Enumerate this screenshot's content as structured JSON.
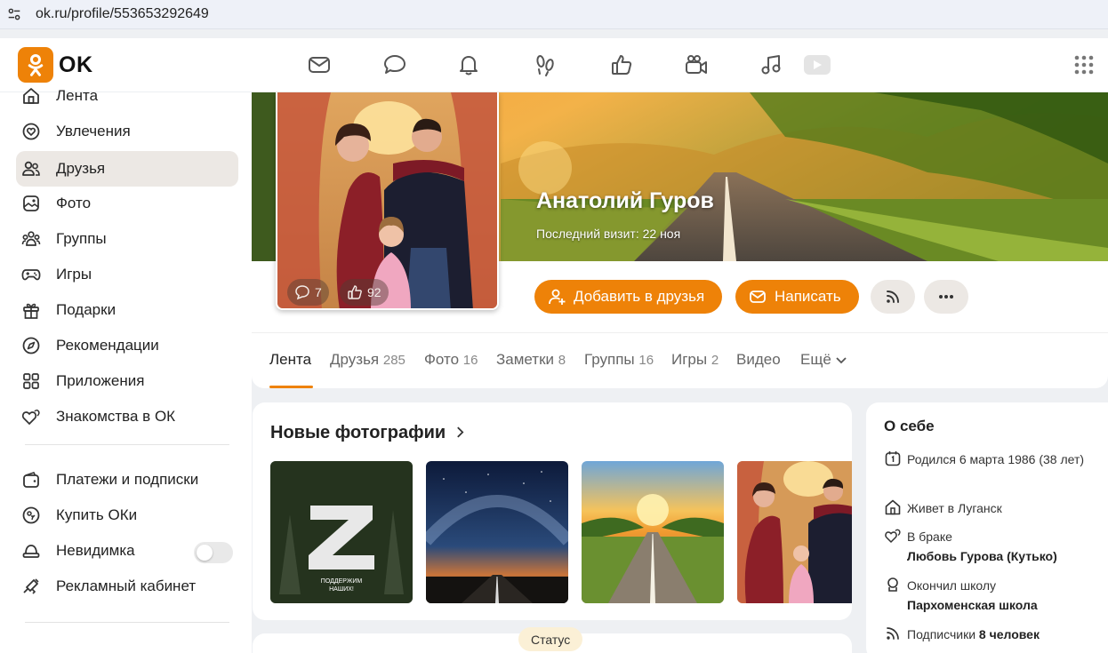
{
  "browser": {
    "url": "ok.ru/profile/553653292649"
  },
  "header": {
    "logo_text": "OK",
    "nav_icons": [
      "mail-icon",
      "chat-icon",
      "bell-icon",
      "footprints-icon",
      "like-icon",
      "video-camera-icon",
      "music-icon",
      "video-play-icon"
    ],
    "apps_icon": "apps-grid-icon"
  },
  "sidebar": {
    "items": [
      {
        "label": "Лента",
        "icon": "home-icon"
      },
      {
        "label": "Увлечения",
        "icon": "heart-circle-icon"
      },
      {
        "label": "Друзья",
        "icon": "friends-icon",
        "active": true
      },
      {
        "label": "Фото",
        "icon": "photo-icon"
      },
      {
        "label": "Группы",
        "icon": "groups-icon"
      },
      {
        "label": "Игры",
        "icon": "gamepad-icon"
      },
      {
        "label": "Подарки",
        "icon": "gift-icon"
      },
      {
        "label": "Рекомендации",
        "icon": "compass-icon"
      },
      {
        "label": "Приложения",
        "icon": "apps-icon"
      },
      {
        "label": "Знакомства в ОК",
        "icon": "hearts-icon"
      }
    ],
    "items2": [
      {
        "label": "Платежи и подписки",
        "icon": "wallet-icon"
      },
      {
        "label": "Купить ОКи",
        "icon": "coin-icon"
      },
      {
        "label": "Невидимка",
        "icon": "invisible-icon",
        "toggle": false
      },
      {
        "label": "Рекламный кабинет",
        "icon": "megaphone-icon"
      }
    ]
  },
  "profile": {
    "name": "Анатолий Гуров",
    "last_visit": "Последний визит: 22 ноя",
    "avatar_comments": "7",
    "avatar_likes": "92",
    "add_friend_label": "Добавить в друзья",
    "write_label": "Написать",
    "tabs": [
      {
        "label": "Лента",
        "count": ""
      },
      {
        "label": "Друзья",
        "count": "285"
      },
      {
        "label": "Фото",
        "count": "16"
      },
      {
        "label": "Заметки",
        "count": "8"
      },
      {
        "label": "Группы",
        "count": "16"
      },
      {
        "label": "Игры",
        "count": "2"
      },
      {
        "label": "Видео",
        "count": ""
      },
      {
        "label": "Ещё",
        "count": ""
      }
    ]
  },
  "photos": {
    "title": "Новые фотографии",
    "z_caption_1": "ПОДДЕРЖИМ",
    "z_caption_2": "НАШИХ!"
  },
  "status_label": "Статус",
  "about": {
    "title": "О себе",
    "born": "Родился 6 марта 1986 (38 лет)",
    "lives": "Живет в Луганск",
    "married_label": "В браке",
    "married_to": "Любовь Гурова (Кутько)",
    "school_label": "Окончил школу",
    "school_name": "Пархоменская школа",
    "subs_label": "Подписчики",
    "subs_value": "8 человек"
  },
  "colors": {
    "accent": "#ee8208",
    "active_bg": "#ece8e4"
  }
}
